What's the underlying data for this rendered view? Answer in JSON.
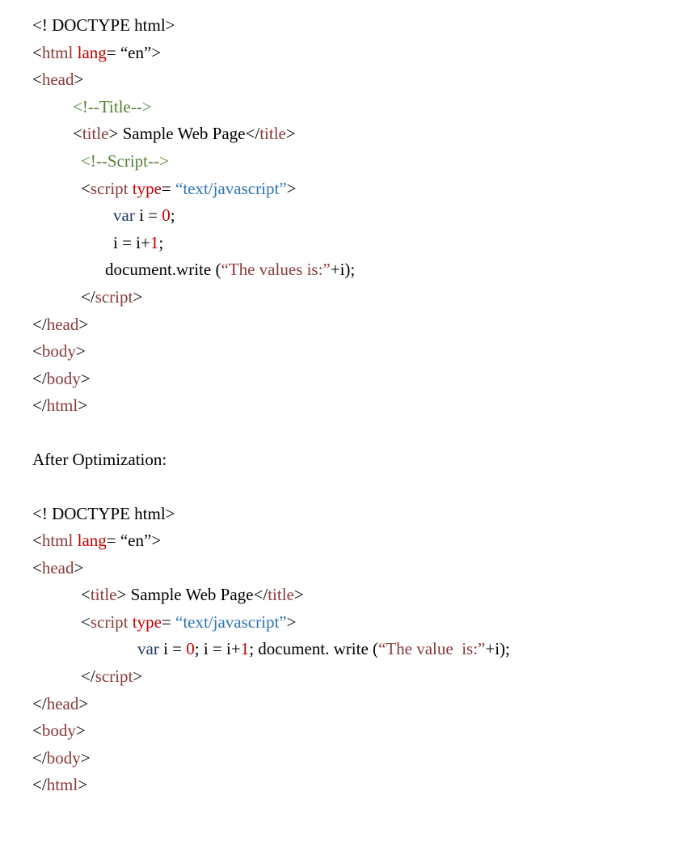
{
  "block1": {
    "l1": {
      "t1": "<! DOCTYPE html>"
    },
    "l2": {
      "t1": "<",
      "t2": "html ",
      "t3": "lang",
      "t4": "= “en”",
      "t5": ">"
    },
    "l3": {
      "t1": "<",
      "t2": "head",
      "t3": ">"
    },
    "l4": {
      "t1": "<!--Title-->"
    },
    "l5": {
      "t1": "<",
      "t2": "title",
      "t3": "> Sample Web Page</",
      "t4": "title",
      "t5": ">"
    },
    "l6": {
      "t1": "<!--Script-->"
    },
    "l7": {
      "t1": "<",
      "t2": "script ",
      "t3": "type",
      "t4": "= ",
      "t5": "“text/javascript”",
      "t6": ">"
    },
    "l8": {
      "t1": "var ",
      "t2": "i = ",
      "t3": "0",
      "t4": ";"
    },
    "l9": {
      "t1": "i = i+",
      "t2": "1",
      "t3": ";"
    },
    "l10": {
      "t1": "document.write (",
      "t2": "“The values is:”",
      "t3": "+i);"
    },
    "l11": {
      "t1": "</",
      "t2": "script",
      "t3": ">"
    },
    "l12": {
      "t1": "</",
      "t2": "head",
      "t3": ">"
    },
    "l13": {
      "t1": "<",
      "t2": "body",
      "t3": ">"
    },
    "l14": {
      "t1": "</",
      "t2": "body",
      "t3": ">"
    },
    "l15": {
      "t1": "</",
      "t2": "html",
      "t3": ">"
    }
  },
  "separator": {
    "label": "After Optimization:"
  },
  "block2": {
    "l1": {
      "t1": "<! DOCTYPE html>"
    },
    "l2": {
      "t1": "<",
      "t2": "html ",
      "t3": "lang",
      "t4": "= “en”",
      "t5": ">"
    },
    "l3": {
      "t1": "<",
      "t2": "head",
      "t3": ">"
    },
    "l4": {
      "t1": "<",
      "t2": "title",
      "t3": "> Sample Web Page</",
      "t4": "title",
      "t5": ">"
    },
    "l5": {
      "t1": "<",
      "t2": "script ",
      "t3": "type",
      "t4": "= ",
      "t5": "“text/javascript”",
      "t6": ">"
    },
    "l6": {
      "t1": "var ",
      "t2": "i = ",
      "t3": "0",
      "t4": "; i = i+",
      "t5": "1",
      "t6": "; document. write (",
      "t7": "“The value  is:”",
      "t8": "+i);"
    },
    "l7": {
      "t1": "</",
      "t2": "script",
      "t3": ">"
    },
    "l8": {
      "t1": "</",
      "t2": "head",
      "t3": ">"
    },
    "l9": {
      "t1": "<",
      "t2": "body",
      "t3": ">"
    },
    "l10": {
      "t1": "</",
      "t2": "body",
      "t3": ">"
    },
    "l11": {
      "t1": "</",
      "t2": "html",
      "t3": ">"
    }
  }
}
